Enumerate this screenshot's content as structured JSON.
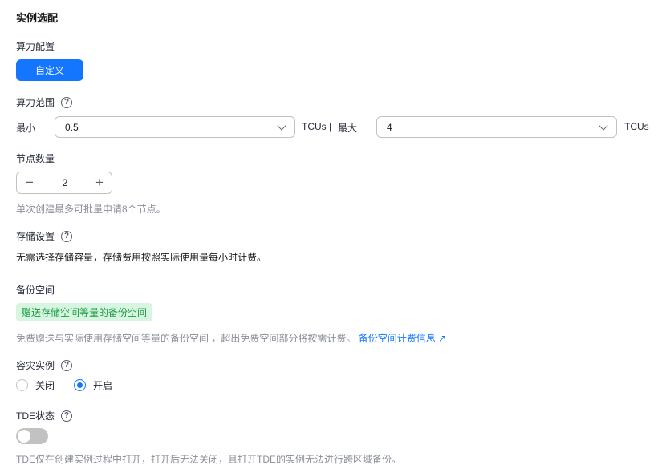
{
  "section_title": "实例选配",
  "compute_config": {
    "label": "算力配置",
    "button": "自定义"
  },
  "compute_range": {
    "label": "算力范围",
    "min_label": "最小",
    "min_value": "0.5",
    "unit_sep": "TCUs |",
    "max_label": "最大",
    "max_value": "4",
    "unit": "TCUs"
  },
  "nodes": {
    "label": "节点数量",
    "minus": "−",
    "value": "2",
    "plus": "+",
    "hint": "单次创建最多可批量申请8个节点。"
  },
  "storage": {
    "label": "存储设置",
    "text": "无需选择存储容量，存储费用按照实际使用量每小时计费。"
  },
  "backup": {
    "label": "备份空间",
    "tag": "赠送存储空间等量的备份空间",
    "desc": "免费赠送与实际使用存储空间等量的备份空间 ，超出免费空间部分将按需计费。",
    "link": "备份空间计费信息"
  },
  "dr": {
    "label": "容灾实例",
    "options": [
      "关闭",
      "开启"
    ],
    "selected": "开启"
  },
  "tde": {
    "label": "TDE状态",
    "enabled": false,
    "hint": "TDE仅在创建实例过程中打开，打开后无法关闭，且打开TDE的实例无法进行跨区域备份。"
  },
  "help_glyph": "?"
}
